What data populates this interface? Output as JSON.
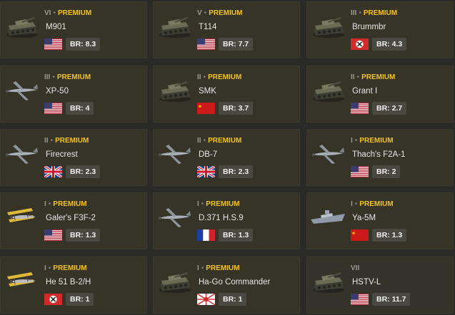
{
  "colors": {
    "premium": "#f2c220",
    "background": "#2a2a27",
    "card": "#33332a"
  },
  "vehicles": [
    {
      "tier": "VI",
      "premium_label": "PREMIUM",
      "name": "M901",
      "country": "usa-flag",
      "br": "BR: 8.3",
      "icon": "tank-icon"
    },
    {
      "tier": "V",
      "premium_label": "PREMIUM",
      "name": "T114",
      "country": "usa-flag",
      "br": "BR: 7.7",
      "icon": "tank-icon"
    },
    {
      "tier": "III",
      "premium_label": "PREMIUM",
      "name": "Brummbr",
      "country": "germany-flag",
      "br": "BR: 4.3",
      "icon": "tank-icon"
    },
    {
      "tier": "III",
      "premium_label": "PREMIUM",
      "name": "XP-50",
      "country": "usa-flag",
      "br": "BR: 4",
      "icon": "plane-icon"
    },
    {
      "tier": "II",
      "premium_label": "PREMIUM",
      "name": "SMK",
      "country": "ussr-flag",
      "br": "BR: 3.7",
      "icon": "tank-icon"
    },
    {
      "tier": "II",
      "premium_label": "PREMIUM",
      "name": "Grant I",
      "country": "usa-flag",
      "br": "BR: 2.7",
      "icon": "tank-icon"
    },
    {
      "tier": "II",
      "premium_label": "PREMIUM",
      "name": "Firecrest",
      "country": "uk-flag",
      "br": "BR: 2.3",
      "icon": "plane-icon"
    },
    {
      "tier": "II",
      "premium_label": "PREMIUM",
      "name": "DB-7",
      "country": "uk-flag",
      "br": "BR: 2.3",
      "icon": "plane-icon"
    },
    {
      "tier": "I",
      "premium_label": "PREMIUM",
      "name": "Thach's F2A-1",
      "country": "usa-flag",
      "br": "BR: 2",
      "icon": "plane-icon"
    },
    {
      "tier": "I",
      "premium_label": "PREMIUM",
      "name": "Galer's F3F-2",
      "country": "usa-flag",
      "br": "BR: 1.3",
      "icon": "biplane-icon"
    },
    {
      "tier": "I",
      "premium_label": "PREMIUM",
      "name": "D.371 H.S.9",
      "country": "france-flag",
      "br": "BR: 1.3",
      "icon": "plane-icon"
    },
    {
      "tier": "I",
      "premium_label": "PREMIUM",
      "name": "Ya-5M",
      "country": "ussr-flag",
      "br": "BR: 1.3",
      "icon": "boat-icon"
    },
    {
      "tier": "I",
      "premium_label": "PREMIUM",
      "name": "He 51 B-2/H",
      "country": "germany-flag",
      "br": "BR: 1",
      "icon": "biplane-icon"
    },
    {
      "tier": "I",
      "premium_label": "PREMIUM",
      "name": "Ha-Go Commander",
      "country": "japan-flag",
      "br": "BR: 1",
      "icon": "tank-icon"
    },
    {
      "tier": "VII",
      "premium_label": "",
      "name": "HSTV-L",
      "country": "usa-flag",
      "br": "BR: 11.7",
      "icon": "tank-icon"
    }
  ]
}
